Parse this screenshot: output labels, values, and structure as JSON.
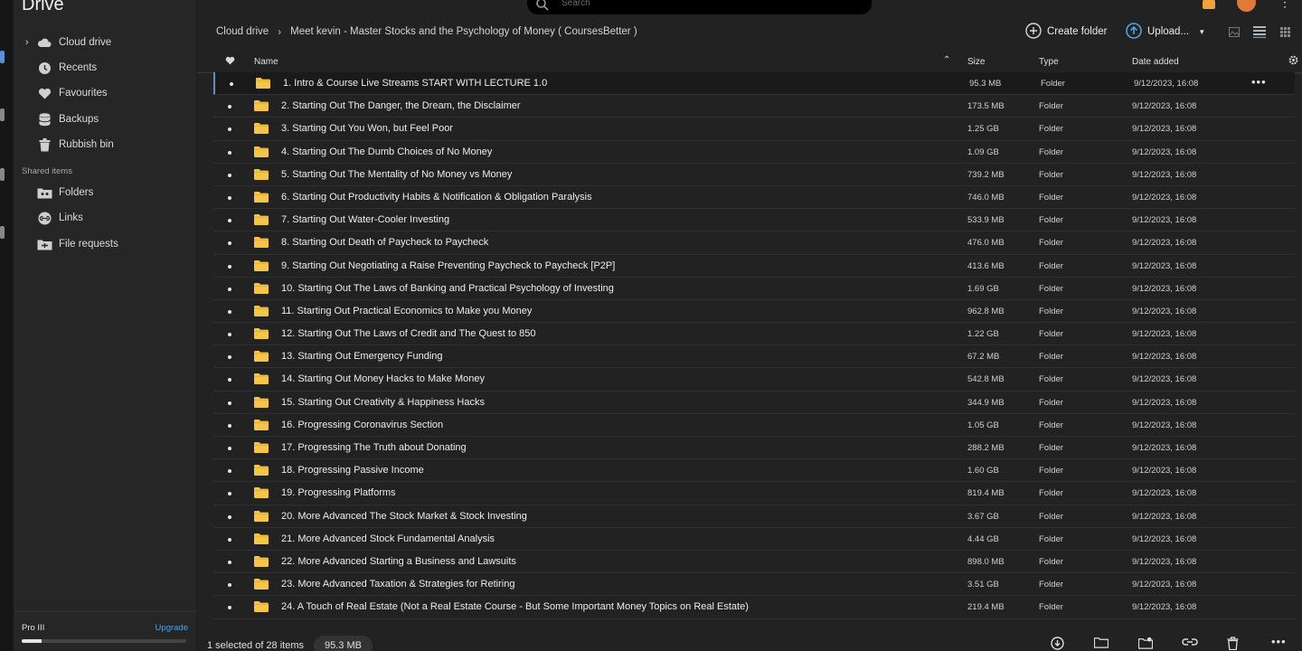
{
  "app": {
    "title": "Drive"
  },
  "search": {
    "placeholder": "Search"
  },
  "sidebar": {
    "items": [
      {
        "label": "Cloud drive",
        "icon": "cloud-icon"
      },
      {
        "label": "Recents",
        "icon": "clock-icon"
      },
      {
        "label": "Favourites",
        "icon": "heart-icon"
      },
      {
        "label": "Backups",
        "icon": "database-icon"
      },
      {
        "label": "Rubbish bin",
        "icon": "trash-icon"
      }
    ],
    "shared_section": "Shared items",
    "shared_items": [
      {
        "label": "Folders",
        "icon": "shared-folder-icon"
      },
      {
        "label": "Links",
        "icon": "link-icon"
      },
      {
        "label": "File requests",
        "icon": "file-request-icon"
      }
    ],
    "plan": "Pro III",
    "upgrade": "Upgrade",
    "storage_fraction": 0.12
  },
  "breadcrumb": {
    "root": "Cloud drive",
    "current": "Meet kevin - Master Stocks and the Psychology of Money ( CoursesBetter )"
  },
  "toolbar": {
    "create_folder": "Create folder",
    "upload": "Upload..."
  },
  "table": {
    "columns": {
      "name": "Name",
      "size": "Size",
      "type": "Type",
      "date": "Date added"
    },
    "rows": [
      {
        "name": "1. Intro & Course Live Streams START WITH LECTURE 1.0",
        "size": "95.3 MB",
        "type": "Folder",
        "date": "9/12/2023, 16:08"
      },
      {
        "name": "2. Starting Out The Danger, the Dream, the Disclaimer",
        "size": "173.5 MB",
        "type": "Folder",
        "date": "9/12/2023, 16:08"
      },
      {
        "name": "3. Starting Out You Won, but Feel Poor",
        "size": "1.25 GB",
        "type": "Folder",
        "date": "9/12/2023, 16:08"
      },
      {
        "name": "4. Starting Out The Dumb Choices of No Money",
        "size": "1.09 GB",
        "type": "Folder",
        "date": "9/12/2023, 16:08"
      },
      {
        "name": "5. Starting Out The Mentality of No Money vs Money",
        "size": "739.2 MB",
        "type": "Folder",
        "date": "9/12/2023, 16:08"
      },
      {
        "name": "6. Starting Out Productivity Habits & Notification & Obligation Paralysis",
        "size": "746.0 MB",
        "type": "Folder",
        "date": "9/12/2023, 16:08"
      },
      {
        "name": "7. Starting Out Water-Cooler Investing",
        "size": "533.9 MB",
        "type": "Folder",
        "date": "9/12/2023, 16:08"
      },
      {
        "name": "8. Starting Out Death of Paycheck to Paycheck",
        "size": "476.0 MB",
        "type": "Folder",
        "date": "9/12/2023, 16:08"
      },
      {
        "name": "9. Starting Out Negotiating a Raise Preventing Paycheck to Paycheck [P2P]",
        "size": "413.6 MB",
        "type": "Folder",
        "date": "9/12/2023, 16:08"
      },
      {
        "name": "10. Starting Out The Laws of Banking and Practical Psychology of Investing",
        "size": "1.69 GB",
        "type": "Folder",
        "date": "9/12/2023, 16:08"
      },
      {
        "name": "11. Starting Out Practical Economics to Make you Money",
        "size": "962.8 MB",
        "type": "Folder",
        "date": "9/12/2023, 16:08"
      },
      {
        "name": "12. Starting Out The Laws of Credit and The Quest to 850",
        "size": "1.22 GB",
        "type": "Folder",
        "date": "9/12/2023, 16:08"
      },
      {
        "name": "13. Starting Out Emergency Funding",
        "size": "67.2 MB",
        "type": "Folder",
        "date": "9/12/2023, 16:08"
      },
      {
        "name": "14. Starting Out Money Hacks to Make Money",
        "size": "542.8 MB",
        "type": "Folder",
        "date": "9/12/2023, 16:08"
      },
      {
        "name": "15. Starting Out Creativity & Happiness Hacks",
        "size": "344.9 MB",
        "type": "Folder",
        "date": "9/12/2023, 16:08"
      },
      {
        "name": "16. Progressing Coronavirus Section",
        "size": "1.05 GB",
        "type": "Folder",
        "date": "9/12/2023, 16:08"
      },
      {
        "name": "17. Progressing The Truth about Donating",
        "size": "288.2 MB",
        "type": "Folder",
        "date": "9/12/2023, 16:08"
      },
      {
        "name": "18. Progressing Passive Income",
        "size": "1.60 GB",
        "type": "Folder",
        "date": "9/12/2023, 16:08"
      },
      {
        "name": "19. Progressing Platforms",
        "size": "819.4 MB",
        "type": "Folder",
        "date": "9/12/2023, 16:08"
      },
      {
        "name": "20. More Advanced The Stock Market & Stock Investing",
        "size": "3.67 GB",
        "type": "Folder",
        "date": "9/12/2023, 16:08"
      },
      {
        "name": "21. More Advanced Stock Fundamental Analysis",
        "size": "4.44 GB",
        "type": "Folder",
        "date": "9/12/2023, 16:08"
      },
      {
        "name": "22. More Advanced Starting a Business and Lawsuits",
        "size": "898.0 MB",
        "type": "Folder",
        "date": "9/12/2023, 16:08"
      },
      {
        "name": "23. More Advanced Taxation & Strategies for Retiring",
        "size": "3.51 GB",
        "type": "Folder",
        "date": "9/12/2023, 16:08"
      },
      {
        "name": "24. A Touch of Real Estate (Not a Real Estate Course - But Some Important Money Topics on Real Estate)",
        "size": "219.4 MB",
        "type": "Folder",
        "date": "9/12/2023, 16:08"
      }
    ]
  },
  "status": {
    "selection": "1 selected of 28 items",
    "selected_size": "95.3 MB"
  },
  "colors": {
    "accent": "#4ea3e6",
    "folder": "#f5c54a",
    "avatar": "#e07a3a"
  }
}
